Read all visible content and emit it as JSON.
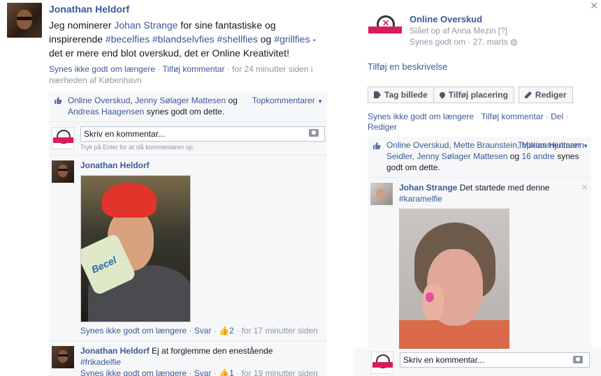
{
  "left_post": {
    "author": "Jonathan Heldorf",
    "text_pre": "Jeg nominerer ",
    "text_mention": "Johan Strange",
    "text_mid": " for sine fantastiske og inspirerende ",
    "tag1": "#becelfies",
    "tag2": "#blandselvfies",
    "tag3": "#shellfies",
    "text_og": " og ",
    "tag4": "#grillfies",
    "text_post": " - det er mere end blot overskud, det er Online Kreativitet!",
    "unlike": "Synes ikke godt om længere",
    "add_comment": "Tilføj kommentar",
    "time": "for 24 minutter siden i nærheden af København",
    "likes_names_1": "Online Overskud",
    "likes_names_2": "Jenny Sølager Mattesen",
    "likes_og": "og",
    "likes_names_3": "Andreas Haagensen",
    "likes_suffix": "synes godt om dette.",
    "top_comments": "Topkommentarer",
    "comment_placeholder": "Skriv en kommentar...",
    "enter_hint": "Tryk på Enter for at slå kommentaren op.",
    "comments": [
      {
        "author": "Jonathan Heldorf",
        "text": "",
        "unlike": "Synes ikke godt om længere",
        "reply": "Svar",
        "like_count": "2",
        "time": "for 17 minutter siden",
        "photo_label": "Becel"
      },
      {
        "author": "Jonathan Heldorf",
        "text": "Ej at forglemme den enestående",
        "tag": "#frikadelfie",
        "unlike": "Synes ikke godt om længere",
        "reply": "Svar",
        "like_count": "1",
        "time": "for 19 minutter siden"
      }
    ]
  },
  "right_panel": {
    "page_name": "Online Overskud",
    "posted_by_prefix": "Slået op af",
    "posted_by": "Anna Mezin",
    "posted_by_badge": "[?]",
    "likes_date_prefix": "Synes godt om",
    "date": "27. marts",
    "add_description": "Tilføj en beskrivelse",
    "buttons": [
      "Tag billede",
      "Tilføj placering",
      "Rediger"
    ],
    "unlike": "Synes ikke godt om længere",
    "add_comment": "Tilføj kommentar",
    "share": "Del",
    "edit": "Rediger",
    "likes_names_1": "Online Overskud, Mette Braunstein, Matias Hjulmann Seidler, Jenny Sølager Mattesen",
    "likes_og": "og",
    "likes_others": "16 andre",
    "likes_suffix": "synes godt om dette.",
    "top_comments": "Topkommentarer",
    "comment": {
      "author": "Johan Strange",
      "text": "Det startede med denne",
      "tag": "#karamelfie"
    },
    "comment_placeholder": "Skriv en kommentar..."
  }
}
